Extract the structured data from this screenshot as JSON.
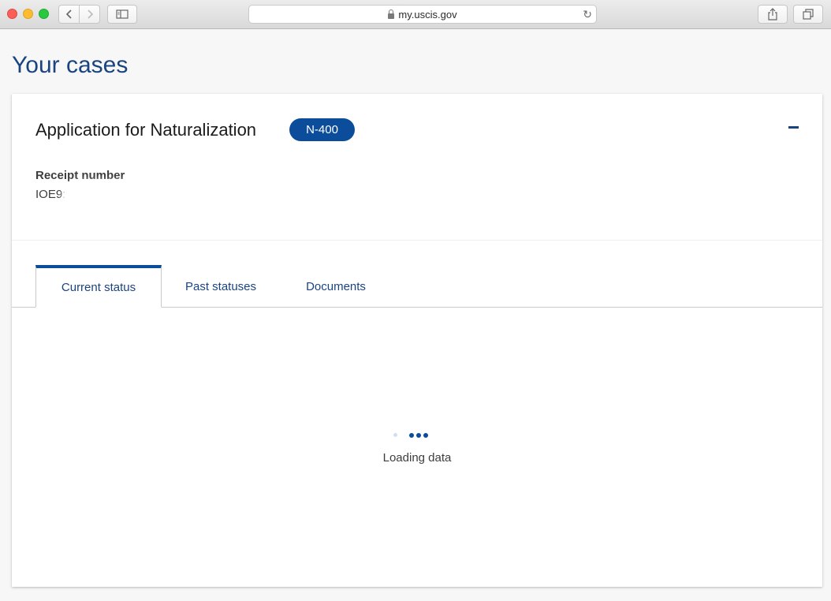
{
  "browser": {
    "url": "my.uscis.gov",
    "icons": {
      "back": "chevron-left-icon",
      "forward": "chevron-right-icon",
      "sidebar": "sidebar-icon",
      "lock": "lock-icon",
      "reload": "reload-icon",
      "share": "share-icon",
      "tabs": "tabs-icon"
    }
  },
  "page": {
    "title": "Your cases"
  },
  "case": {
    "title": "Application for Naturalization",
    "form_badge": "N-400",
    "receipt_label": "Receipt number",
    "receipt_value": "IOE9:"
  },
  "tabs": [
    {
      "label": "Current status",
      "active": true
    },
    {
      "label": "Past statuses",
      "active": false
    },
    {
      "label": "Documents",
      "active": false
    }
  ],
  "loading": {
    "text": "Loading data"
  },
  "colors": {
    "primary": "#1a4480",
    "badge": "#0b4d9a"
  }
}
